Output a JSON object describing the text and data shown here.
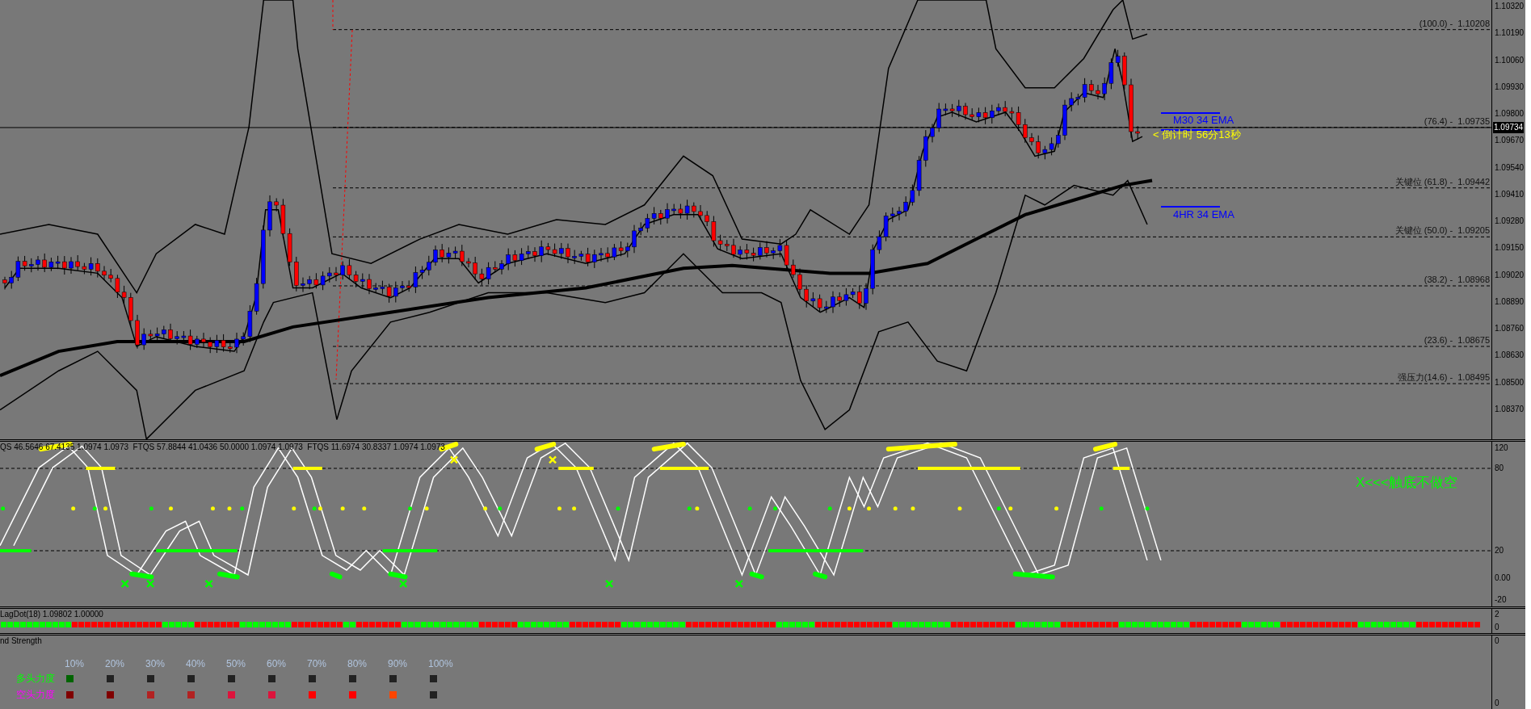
{
  "main_chart": {
    "price_axis": [
      "1.10320",
      "1.10190",
      "1.10060",
      "1.09930",
      "1.09800",
      "1.09670",
      "1.09540",
      "1.09410",
      "1.09280",
      "1.09150",
      "1.09020",
      "1.08890",
      "1.08760",
      "1.08630",
      "1.08500",
      "1.08370"
    ],
    "current_price": "1.09734",
    "fib_levels": [
      {
        "label": "(100.0) -",
        "price": "1.10208"
      },
      {
        "label": "(76.4) -",
        "price": "1.09735"
      },
      {
        "label": "关键位 (61.8) -",
        "price": "1.09442"
      },
      {
        "label": "关键位 (50.0) -",
        "price": "1.09205"
      },
      {
        "label": "(38.2) -",
        "price": "1.08968"
      },
      {
        "label": "(23.6) -",
        "price": "1.08675"
      },
      {
        "label": "强压力(14.6) -",
        "price": "1.08495"
      }
    ],
    "ema_labels": [
      {
        "label": "M30 34 EMA",
        "kind": "upper"
      },
      {
        "label": "4HR 34 EMA",
        "kind": "lower"
      }
    ],
    "countdown": "< 倒计时 56分13秒"
  },
  "oscillator": {
    "header": "QS 46.5646 67.4135 1.0974 1.0973  FTQS 57.8844 41.0436 50.0000 1.0974 1.0973  FTQS 11.6974 30.8337 1.0974 1.0973",
    "axis": [
      "120",
      "80",
      "20",
      "0.00",
      "-20"
    ],
    "annotation": "X<<<触底不做空"
  },
  "lagdot": {
    "header": "LagDot(18) 1.09802 1.00000",
    "axis": [
      "2",
      "0"
    ]
  },
  "strength": {
    "header": "nd Strength",
    "columns": [
      "10%",
      "20%",
      "30%",
      "40%",
      "50%",
      "60%",
      "70%",
      "80%",
      "90%",
      "100%"
    ],
    "rows": [
      {
        "label": "多头力度",
        "color": "#00ff00",
        "cells": [
          {
            "color": "#006400"
          },
          {
            "color": "#222222"
          },
          {
            "color": "#222222"
          },
          {
            "color": "#222222"
          },
          {
            "color": "#222222"
          },
          {
            "color": "#222222"
          },
          {
            "color": "#222222"
          },
          {
            "color": "#222222"
          },
          {
            "color": "#222222"
          },
          {
            "color": "#222222"
          }
        ]
      },
      {
        "label": "空头力度",
        "color": "#ff00ff",
        "cells": [
          {
            "color": "#800000"
          },
          {
            "color": "#800000"
          },
          {
            "color": "#b22222"
          },
          {
            "color": "#b22222"
          },
          {
            "color": "#dc143c"
          },
          {
            "color": "#dc143c"
          },
          {
            "color": "#ff0000"
          },
          {
            "color": "#ff0000"
          },
          {
            "color": "#ff4500"
          },
          {
            "color": "#222222"
          }
        ]
      }
    ],
    "axis": [
      "0",
      "0"
    ]
  }
}
